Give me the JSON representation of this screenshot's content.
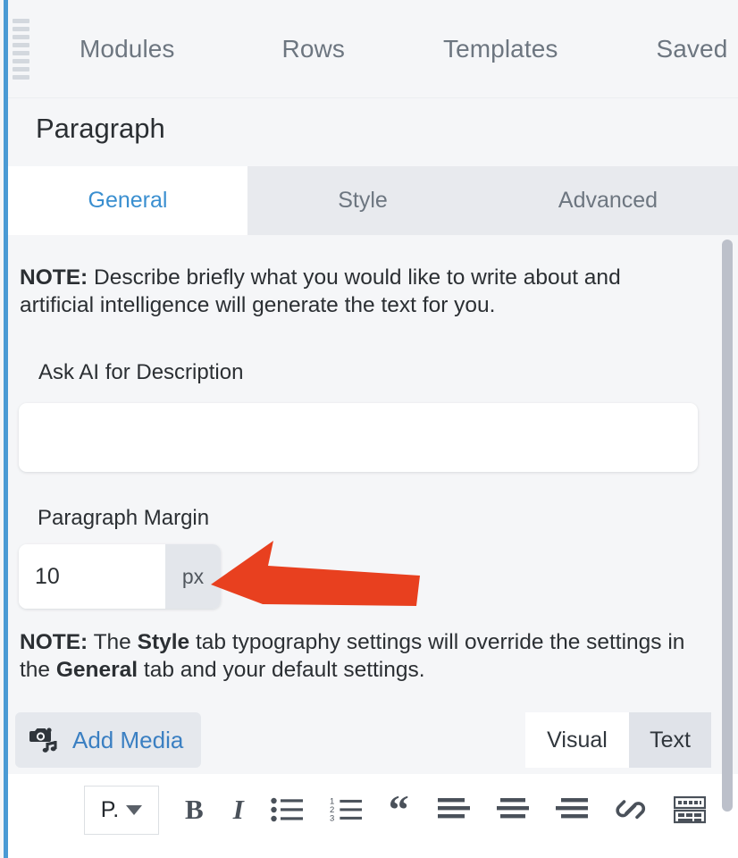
{
  "header": {
    "drag_handle": "drag-grip",
    "nav_tabs": [
      {
        "label": "Modules"
      },
      {
        "label": "Rows"
      },
      {
        "label": "Templates"
      },
      {
        "label": "Saved"
      }
    ]
  },
  "module": {
    "title": "Paragraph",
    "settings_tabs": [
      {
        "label": "General",
        "active": true
      },
      {
        "label": "Style",
        "active": false
      },
      {
        "label": "Advanced",
        "active": false
      }
    ]
  },
  "general_tab": {
    "note_1": {
      "prefix": "NOTE:",
      "text": " Describe briefly what you would like to write about and artificial intelligence will generate the text for you."
    },
    "ask_ai": {
      "label": "Ask AI for Description",
      "value": "",
      "placeholder": ""
    },
    "paragraph_margin": {
      "label": "Paragraph Margin",
      "value": "10",
      "unit": "px"
    },
    "note_2": {
      "prefix": "NOTE:",
      "part1": " The ",
      "bold1": "Style",
      "part2": " tab typography settings will override the settings in the ",
      "bold2": "General",
      "part3": " tab and your default settings."
    }
  },
  "editor": {
    "add_media_label": "Add Media",
    "add_media_icon": "camera-music-icon",
    "mode_toggle": [
      {
        "label": "Visual",
        "active": true
      },
      {
        "label": "Text",
        "active": false
      }
    ],
    "toolbar": [
      {
        "name": "paragraph-format-dropdown",
        "label": "P."
      },
      {
        "name": "bold-button",
        "label": "B"
      },
      {
        "name": "italic-button",
        "label": "I"
      },
      {
        "name": "bullet-list-button",
        "label": ""
      },
      {
        "name": "numbered-list-button",
        "label": ""
      },
      {
        "name": "blockquote-button",
        "label": "“"
      },
      {
        "name": "align-left-button",
        "label": ""
      },
      {
        "name": "align-center-button",
        "label": ""
      },
      {
        "name": "align-right-button",
        "label": ""
      },
      {
        "name": "insert-link-button",
        "label": ""
      },
      {
        "name": "toolbar-toggle-button",
        "label": ""
      }
    ]
  },
  "annotation": {
    "arrow_color": "#e8401f",
    "points_at": "paragraph-margin-field"
  },
  "colors": {
    "accent_blue": "#4a9ad4",
    "tab_active_text": "#3a8fd0",
    "link_blue": "#3a7fc2",
    "panel_bg": "#f5f6f8",
    "tabs_bg": "#e8eaee",
    "scrollbar": "#bcc0ca"
  }
}
